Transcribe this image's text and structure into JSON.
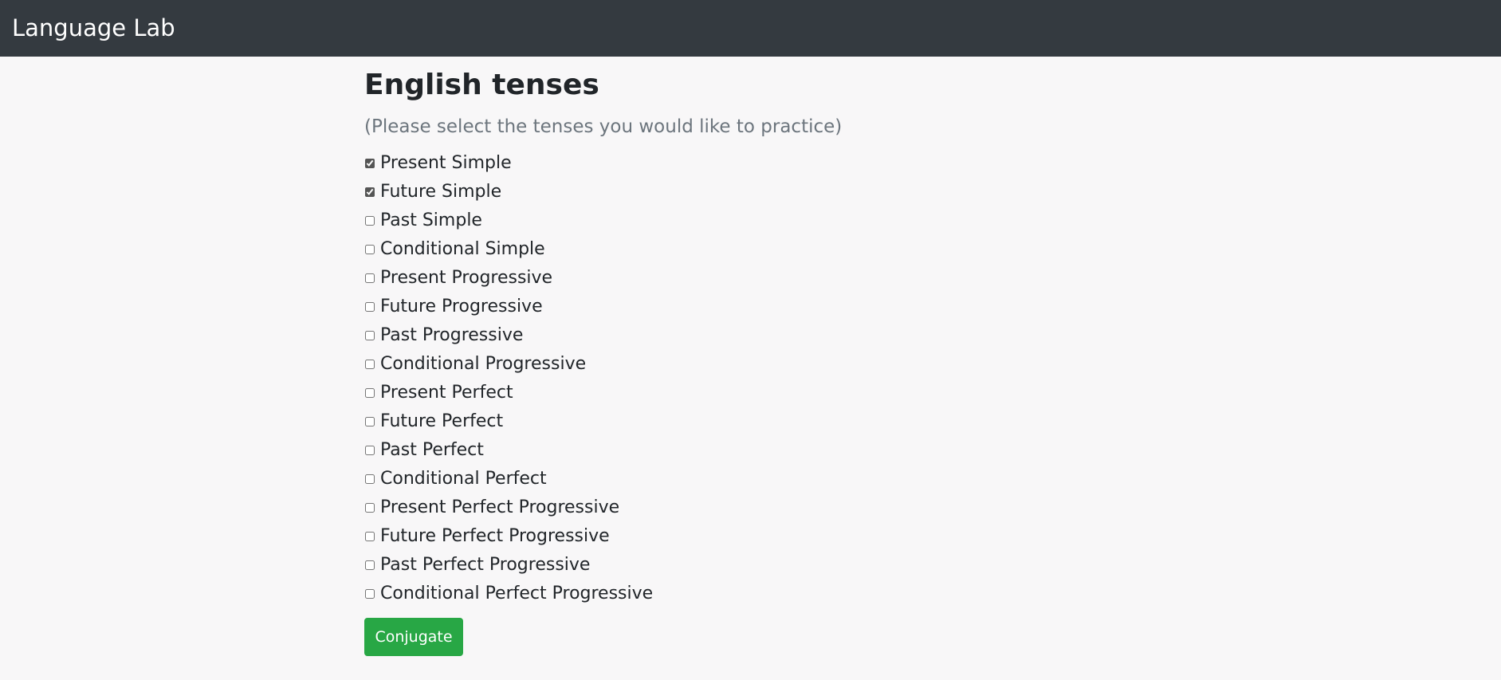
{
  "navbar": {
    "brand": "Language Lab"
  },
  "main": {
    "title": "English tenses",
    "subtitle": "(Please select the tenses you would like to practice)",
    "tenses": [
      {
        "label": "Present Simple",
        "checked": true
      },
      {
        "label": "Future Simple",
        "checked": true
      },
      {
        "label": "Past Simple",
        "checked": false
      },
      {
        "label": "Conditional Simple",
        "checked": false
      },
      {
        "label": "Present Progressive",
        "checked": false
      },
      {
        "label": "Future Progressive",
        "checked": false
      },
      {
        "label": "Past Progressive",
        "checked": false
      },
      {
        "label": "Conditional Progressive",
        "checked": false
      },
      {
        "label": "Present Perfect",
        "checked": false
      },
      {
        "label": "Future Perfect",
        "checked": false
      },
      {
        "label": "Past Perfect",
        "checked": false
      },
      {
        "label": "Conditional Perfect",
        "checked": false
      },
      {
        "label": "Present Perfect Progressive",
        "checked": false
      },
      {
        "label": "Future Perfect Progressive",
        "checked": false
      },
      {
        "label": "Past Perfect Progressive",
        "checked": false
      },
      {
        "label": "Conditional Perfect Progressive",
        "checked": false
      }
    ],
    "submit_label": "Conjugate"
  },
  "colors": {
    "navbar_bg": "#343a40",
    "page_bg": "#f8f7f8",
    "button_bg": "#28a745",
    "subtitle_text": "#6c757d"
  }
}
